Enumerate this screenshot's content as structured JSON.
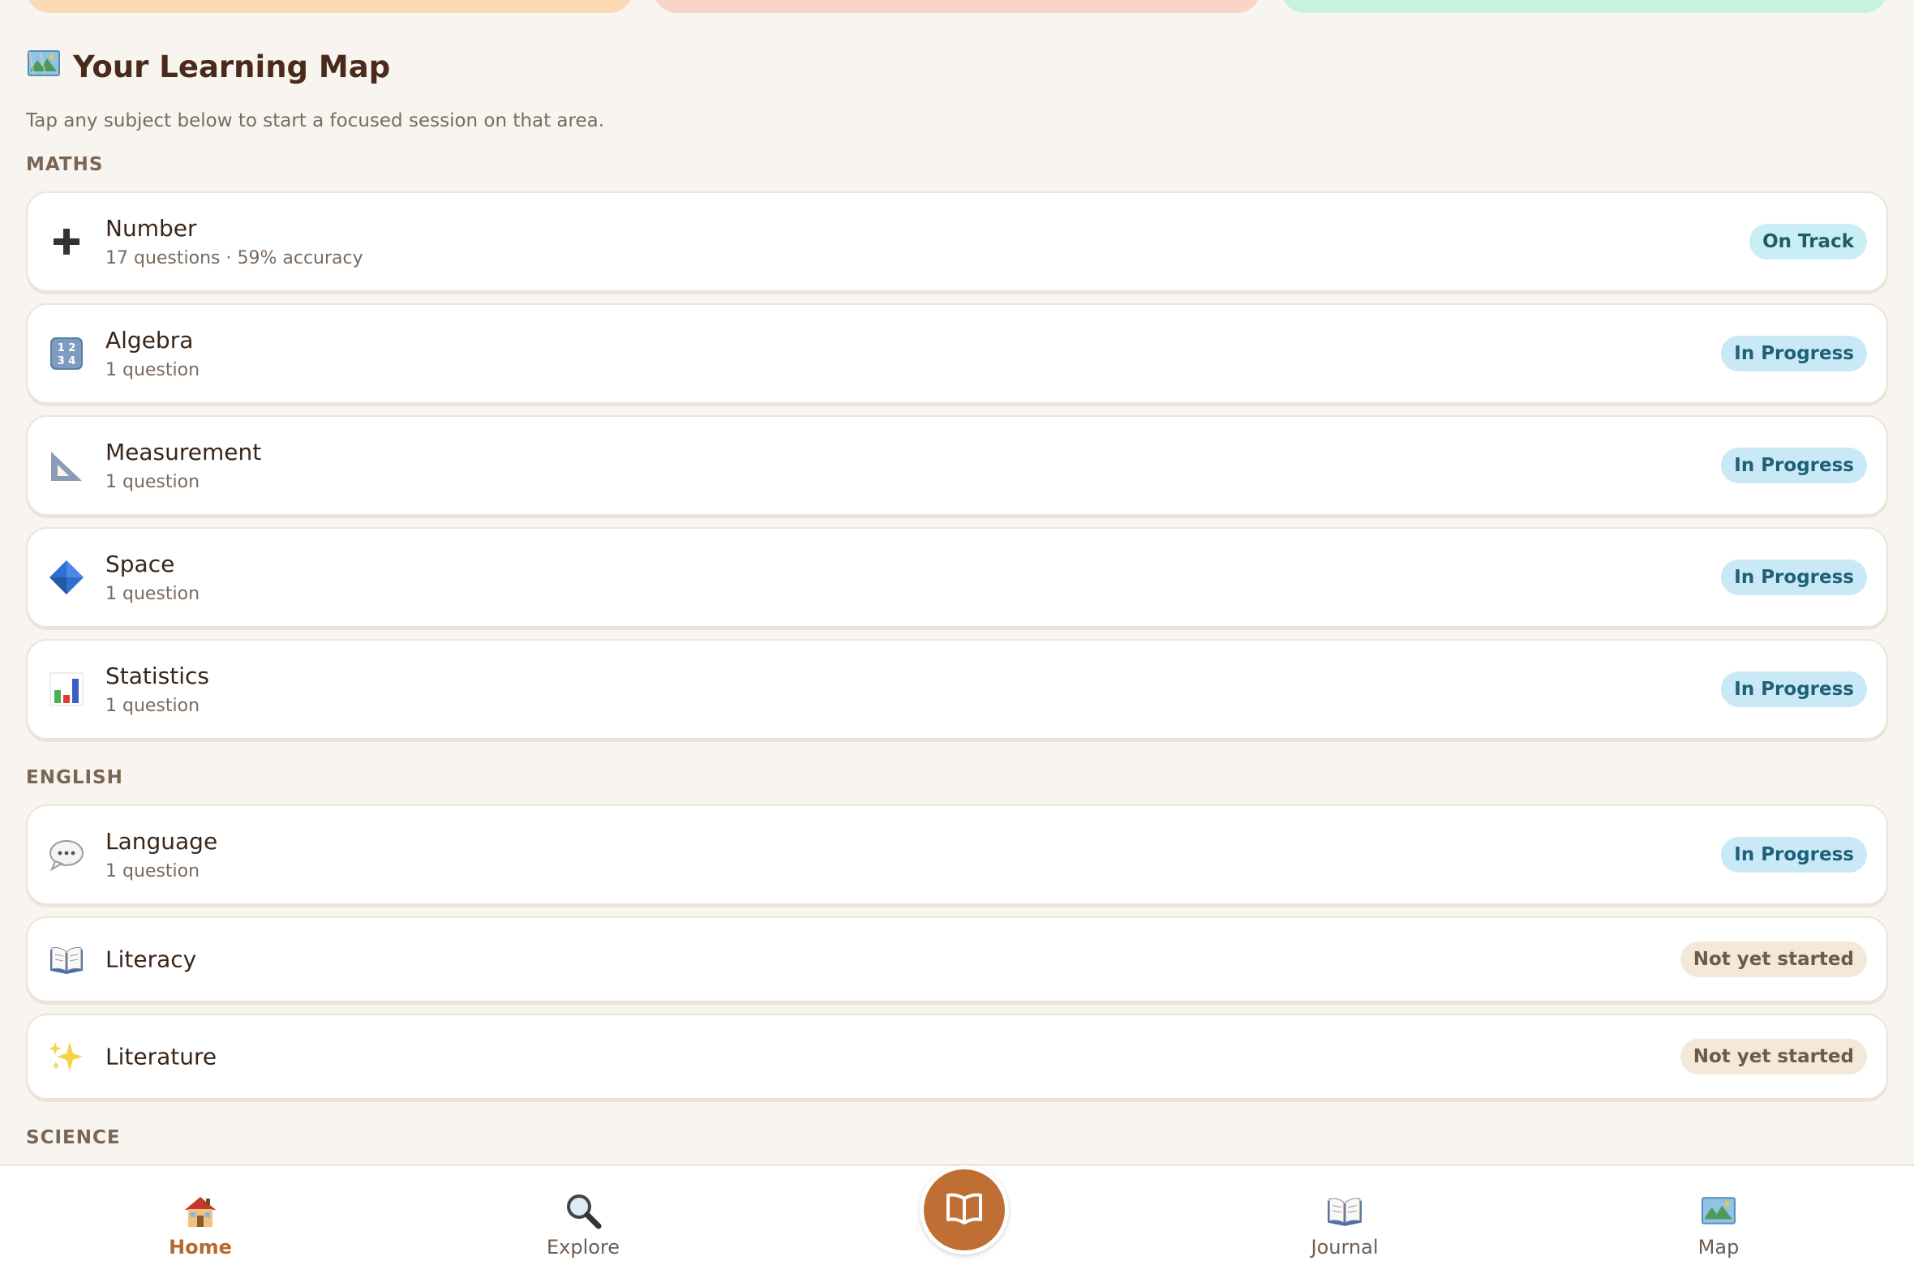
{
  "colors": {
    "top_card_1": "#fbd9b4",
    "top_card_2": "#f9d2c8",
    "top_card_3": "#c5f3dc",
    "accent": "#bf6f33"
  },
  "header": {
    "title": "Your Learning Map",
    "title_icon": "map-icon",
    "subtitle": "Tap any subject below to start a focused session on that area."
  },
  "sections": {
    "maths": {
      "label": "MATHS",
      "items": [
        {
          "name": "Number",
          "meta": "17 questions · 59% accuracy",
          "status": "On Track",
          "icon": "plus-icon"
        },
        {
          "name": "Algebra",
          "meta": "1 question",
          "status": "In Progress",
          "icon": "numbers-icon"
        },
        {
          "name": "Measurement",
          "meta": "1 question",
          "status": "In Progress",
          "icon": "ruler-triangle-icon"
        },
        {
          "name": "Space",
          "meta": "1 question",
          "status": "In Progress",
          "icon": "diamond-icon"
        },
        {
          "name": "Statistics",
          "meta": "1 question",
          "status": "In Progress",
          "icon": "bar-chart-icon"
        }
      ]
    },
    "english": {
      "label": "ENGLISH",
      "items": [
        {
          "name": "Language",
          "meta": "1 question",
          "status": "In Progress",
          "icon": "speech-bubble-icon"
        },
        {
          "name": "Literacy",
          "meta": "",
          "status": "Not yet started",
          "icon": "open-book-icon"
        },
        {
          "name": "Literature",
          "meta": "",
          "status": "Not yet started",
          "icon": "sparkles-icon"
        }
      ]
    },
    "science": {
      "label": "SCIENCE"
    }
  },
  "nav": {
    "home": {
      "label": "Home",
      "icon": "house-icon"
    },
    "explore": {
      "label": "Explore",
      "icon": "magnifier-icon"
    },
    "center": {
      "icon": "open-book-icon"
    },
    "journal": {
      "label": "Journal",
      "icon": "journal-book-icon"
    },
    "map": {
      "label": "Map",
      "icon": "map-icon"
    }
  }
}
